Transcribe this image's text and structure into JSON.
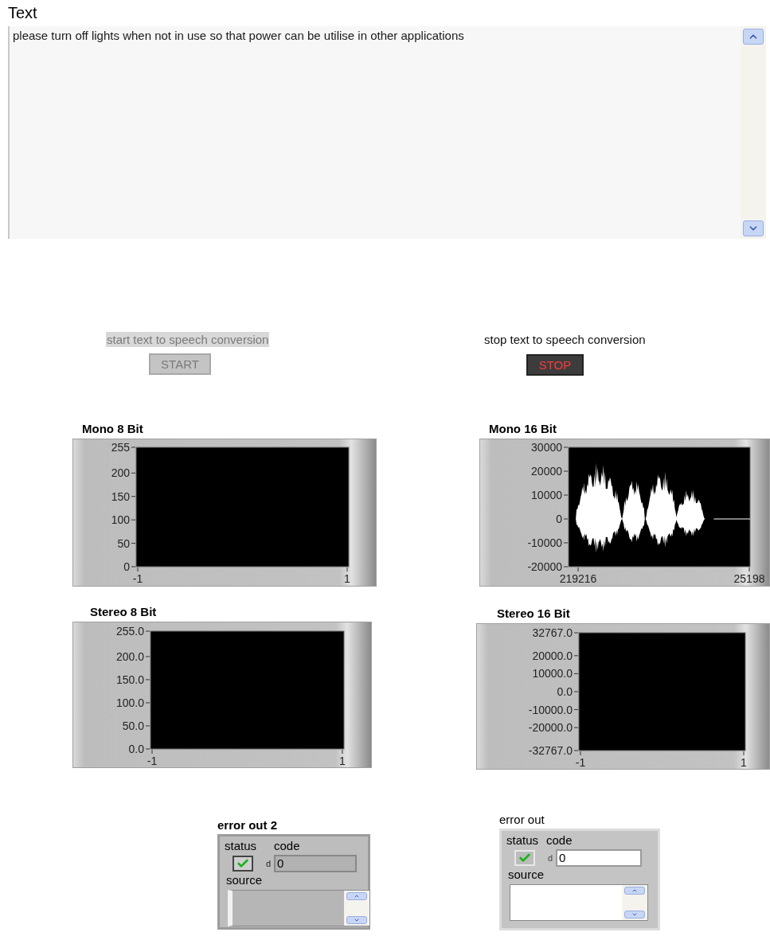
{
  "text_panel": {
    "label": "Text",
    "value": "please turn off lights when not in use so that power can be utilise in other applications"
  },
  "controls": [
    {
      "label": "start text to speech conversion",
      "button": "START",
      "disabled": true
    },
    {
      "label": "stop text to speech conversion",
      "button": "STOP",
      "disabled": false
    }
  ],
  "charts": [
    {
      "waveform": false,
      "chart_data": {
        "type": "line",
        "title": "Mono 8 Bit",
        "categories": [
          "-1",
          "1"
        ],
        "ylim": [
          0,
          255
        ],
        "yticks": [
          0,
          50,
          100,
          150,
          200,
          255
        ]
      }
    },
    {
      "waveform": true,
      "chart_data": {
        "type": "line",
        "title": "Mono 16 Bit",
        "categories": [
          "219216",
          "25198"
        ],
        "ylim": [
          -20000,
          30000
        ],
        "yticks": [
          -20000,
          -10000,
          0,
          10000,
          20000,
          30000
        ]
      }
    },
    {
      "waveform": false,
      "chart_data": {
        "type": "line",
        "title": "Stereo 8 Bit",
        "categories": [
          "-1",
          "1"
        ],
        "ylim": [
          0,
          255
        ],
        "yticks": [
          {
            "value": 0,
            "label": "0.0"
          },
          {
            "value": 50,
            "label": "50.0"
          },
          {
            "value": 100,
            "label": "100.0"
          },
          {
            "value": 150,
            "label": "150.0"
          },
          {
            "value": 200,
            "label": "200.0"
          },
          {
            "value": 255,
            "label": "255.0"
          }
        ]
      }
    },
    {
      "waveform": false,
      "chart_data": {
        "type": "line",
        "title": "Stereo 16 Bit",
        "categories": [
          "-1",
          "1"
        ],
        "ylim": [
          -32767,
          32767
        ],
        "yticks": [
          {
            "value": -32767,
            "label": "-32767.0"
          },
          {
            "value": -20000,
            "label": "-20000.0"
          },
          {
            "value": -10000,
            "label": "-10000.0"
          },
          {
            "value": 0,
            "label": "0.0"
          },
          {
            "value": 10000,
            "label": "10000.0"
          },
          {
            "value": 20000,
            "label": "20000.0"
          },
          {
            "value": 32767,
            "label": "32767.0"
          }
        ]
      }
    }
  ],
  "errors": [
    {
      "title": "error out 2",
      "disabled": true,
      "status_label": "status",
      "code_label": "code",
      "status": true,
      "radix": "d",
      "code": "0",
      "source_label": "source"
    },
    {
      "title": "error out",
      "disabled": false,
      "status_label": "status",
      "code_label": "code",
      "status": true,
      "radix": "d",
      "code": "0",
      "source_label": "source"
    }
  ]
}
